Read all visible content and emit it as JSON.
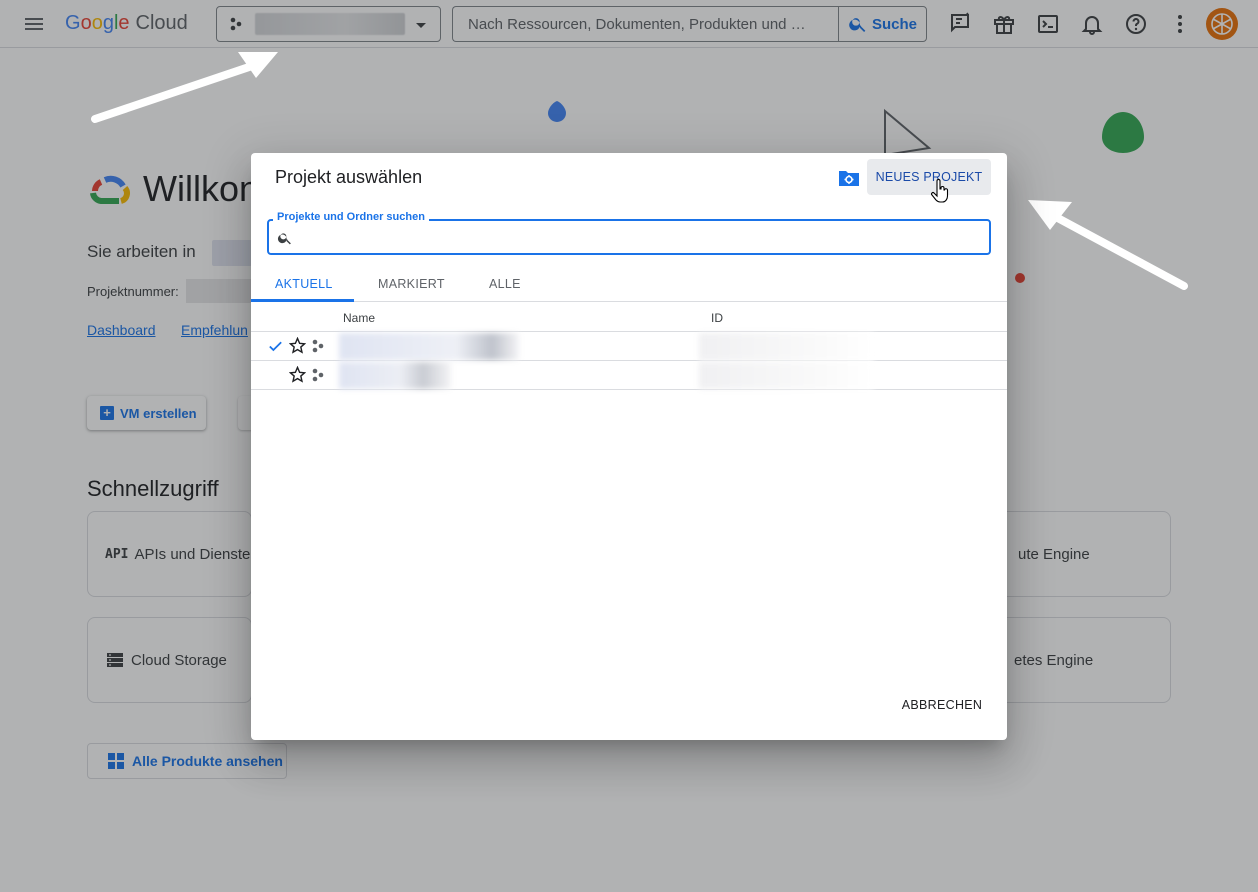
{
  "header": {
    "logo_google": [
      "G",
      "o",
      "o",
      "g",
      "l",
      "e"
    ],
    "logo_cloud": "Cloud",
    "search_placeholder": "Nach Ressourcen, Dokumenten, Produkten und …",
    "search_button": "Suche",
    "icons": [
      "menu-icon",
      "project-icon",
      "chevron-down-icon",
      "search-icon",
      "feedback-icon",
      "gift-icon",
      "terminal-icon",
      "bell-icon",
      "help-icon",
      "more-vert-icon",
      "avatar"
    ]
  },
  "page": {
    "welcome_title": "Willkon",
    "working_in": "Sie arbeiten in",
    "project_number_label": "Projektnummer:",
    "links": [
      "Dashboard",
      "Empfehlun"
    ],
    "vm_button": "VM erstellen",
    "quick_access_title": "Schnellzugriff",
    "cards_left": [
      "APIs und Dienste",
      "Cloud Storage"
    ],
    "cards_right": [
      "ute Engine",
      "etes Engine"
    ],
    "all_products_button": "Alle Produkte ansehen"
  },
  "dialog": {
    "title": "Projekt auswählen",
    "new_project_button": "NEUES PROJEKT",
    "search_label": "Projekte und Ordner suchen",
    "search_value": "",
    "tabs": [
      "AKTUELL",
      "MARKIERT",
      "ALLE"
    ],
    "active_tab": "AKTUELL",
    "columns": [
      "Name",
      "ID"
    ],
    "rows": [
      {
        "selected": true,
        "starred": false
      },
      {
        "selected": false,
        "starred": false
      }
    ],
    "cancel_button": "ABBRECHEN"
  },
  "colors": {
    "accent": "#1a73e8",
    "avatar": "#e8710a",
    "scrim": "rgba(32,33,36,0.35)"
  }
}
